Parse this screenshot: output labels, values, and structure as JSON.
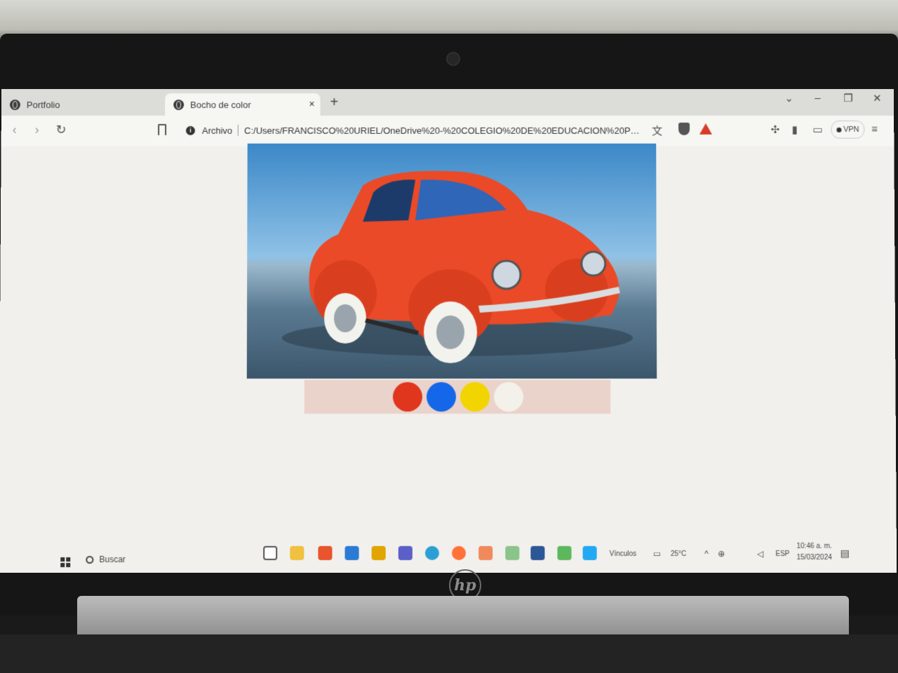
{
  "browser": {
    "tabs": [
      {
        "label": "Portfolio",
        "active": false
      },
      {
        "label": "Bocho de color",
        "active": true
      }
    ],
    "new_tab_symbol": "+",
    "close_symbol": "×",
    "window_controls": [
      "⌄",
      "–",
      "❐",
      "✕"
    ],
    "address": {
      "scheme_label": "Archivo",
      "url": "C:/Users/FRANCISCO%20URIEL/OneDrive%20-%20COLEGIO%20DE%20EDUCACION%20PROFESI..."
    },
    "vpn_label": "VPN",
    "icons": [
      "back-icon",
      "forward-icon",
      "reload-icon",
      "bookmark-icon",
      "info-icon",
      "translate-icon",
      "brave-shields-icon",
      "rewards-icon",
      "extensions-icon",
      "sidebar-icon",
      "wallet-icon",
      "menu-icon"
    ]
  },
  "page": {
    "image_subject": "car-photo",
    "palette": {
      "colors": [
        "#e0361e",
        "#1467e8",
        "#f2d500",
        "#f4f1ea"
      ],
      "background": "#ead3cb"
    }
  },
  "taskbar": {
    "search_label": "Buscar",
    "links_label": "Vínculos",
    "temperature": "25°C",
    "language": "ESP",
    "time": "10:46 a. m.",
    "date": "15/03/2024"
  },
  "device": {
    "brand": "hp"
  }
}
